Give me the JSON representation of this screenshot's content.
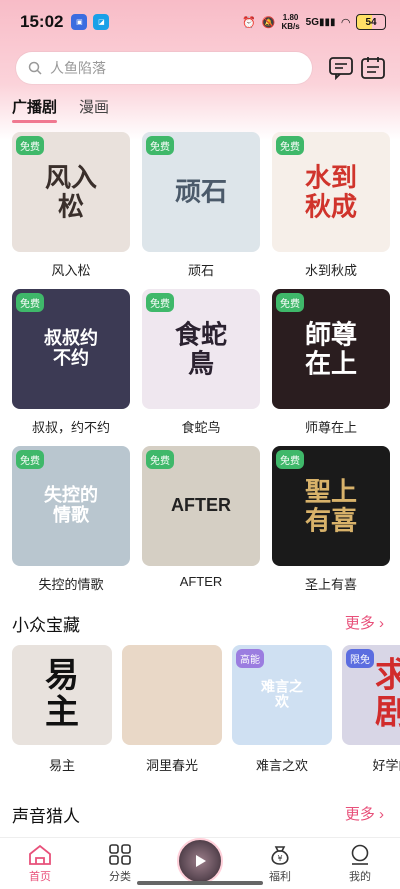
{
  "status": {
    "time": "15:02",
    "speed_top": "1.80",
    "speed_unit": "KB/s",
    "net": "5G",
    "battery": "54"
  },
  "search": {
    "placeholder": "人鱼陷落"
  },
  "tabs": [
    {
      "label": "广播剧",
      "active": true
    },
    {
      "label": "漫画",
      "active": false
    }
  ],
  "grid": [
    {
      "title": "风入松",
      "badge": "免费",
      "art": "风入松",
      "bg": "#e9e1dc",
      "fg": "#3a2f2b"
    },
    {
      "title": "顽石",
      "badge": "免费",
      "art": "顽石",
      "bg": "#dde5ea",
      "fg": "#4b5a6a"
    },
    {
      "title": "水到秋成",
      "badge": "免费",
      "art": "水到秋成",
      "bg": "#f6efe9",
      "fg": "#d0342c"
    },
    {
      "title": "叔叔，约不约",
      "badge": "免费",
      "art": "叔叔约不约",
      "bg": "#3c3a54",
      "fg": "#ffffff"
    },
    {
      "title": "食蛇鸟",
      "badge": "免费",
      "art": "食蛇鳥",
      "bg": "#efe7ef",
      "fg": "#2b2230"
    },
    {
      "title": "师尊在上",
      "badge": "免费",
      "art": "師尊在上",
      "bg": "#2a1d1f",
      "fg": "#ffffff"
    },
    {
      "title": "失控的情歌",
      "badge": "免费",
      "art": "失控的情歌",
      "bg": "#b9c6cf",
      "fg": "#ffffff"
    },
    {
      "title": "AFTER",
      "badge": "免费",
      "art": "AFTER",
      "bg": "#d5cfc4",
      "fg": "#222222"
    },
    {
      "title": "圣上有喜",
      "badge": "免费",
      "art": "聖上有喜",
      "bg": "#1a1a1a",
      "fg": "#d8b26a"
    }
  ],
  "section1": {
    "title": "小众宝藏",
    "more": "更多"
  },
  "row1": [
    {
      "title": "易主",
      "tag": "",
      "art": "易主",
      "bg": "#e8e2dd",
      "fg": "#111111",
      "tag_color": ""
    },
    {
      "title": "洞里春光",
      "tag": "",
      "art": "",
      "bg": "#e9d8c7",
      "fg": "#333333",
      "tag_color": ""
    },
    {
      "title": "难言之欢",
      "tag": "高能",
      "art": "难言之欢",
      "bg": "#cfe0f2",
      "fg": "#ffffff",
      "tag_color": "#9b7de0"
    },
    {
      "title": "好学的",
      "tag": "限免",
      "art": "求剧",
      "bg": "#d8d6e6",
      "fg": "#d12c2c",
      "tag_color": "#5b6de0"
    }
  ],
  "section2": {
    "title": "声音猎人",
    "more": "更多"
  },
  "nav": [
    {
      "label": "首页",
      "icon": "home-icon",
      "active": true
    },
    {
      "label": "分类",
      "icon": "grid-icon",
      "active": false
    },
    {
      "label": "",
      "icon": "play-icon",
      "active": false
    },
    {
      "label": "福利",
      "icon": "money-bag-icon",
      "active": false
    },
    {
      "label": "我的",
      "icon": "person-icon",
      "active": false
    }
  ]
}
